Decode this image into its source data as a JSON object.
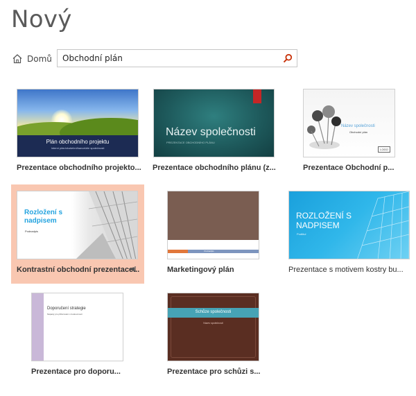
{
  "header": {
    "title": "Nový"
  },
  "nav": {
    "home_label": "Domů"
  },
  "search": {
    "value": "Obchodní plán",
    "placeholder": ""
  },
  "templates": [
    {
      "caption": "Prezentace obchodního projekto...",
      "thumb_title": "Plán obchodního projektu",
      "thumb_sub": "Interní plán/zkušební/kanceláře společnosti"
    },
    {
      "caption": "Prezentace obchodního plánu (z...",
      "thumb_title": "Název společnosti",
      "thumb_sub": "PREZENTACE OBCHODNÍHO PLÁNU"
    },
    {
      "caption": "Prezentace Obchodní p...",
      "thumb_title": "Název společnosti",
      "thumb_sub": "Obchodní plán",
      "thumb_logo": "LOGO"
    },
    {
      "caption": "Kontrastní obchodní prezentace...",
      "thumb_title": "Rozložení s nadpisem",
      "thumb_sub": "Podnadpis",
      "selected": true
    },
    {
      "caption": "Marketingový plán",
      "thumb_title": "MARKETINGOVÝ PLÁN",
      "thumb_sub": "Podnadpis"
    },
    {
      "caption": "Prezentace s motivem kostry bu...",
      "thumb_title": "ROZLOŽENÍ S NADPISEM",
      "thumb_sub": "Podtitul"
    },
    {
      "caption": "Prezentace pro doporu...",
      "thumb_title": "Doporučení strategie",
      "thumb_sub": "Nápady pro přiřazování s budoucností"
    },
    {
      "caption": "Prezentace pro schůzi s...",
      "thumb_title": "Schůze společnosti",
      "thumb_sub": "Název společnosti"
    }
  ],
  "colors": {
    "selected_bg": "#f9c7b1",
    "search_icon": "#c8330b"
  },
  "icons": {
    "home": "home-icon",
    "search": "search-icon",
    "pin": "pin-icon"
  }
}
